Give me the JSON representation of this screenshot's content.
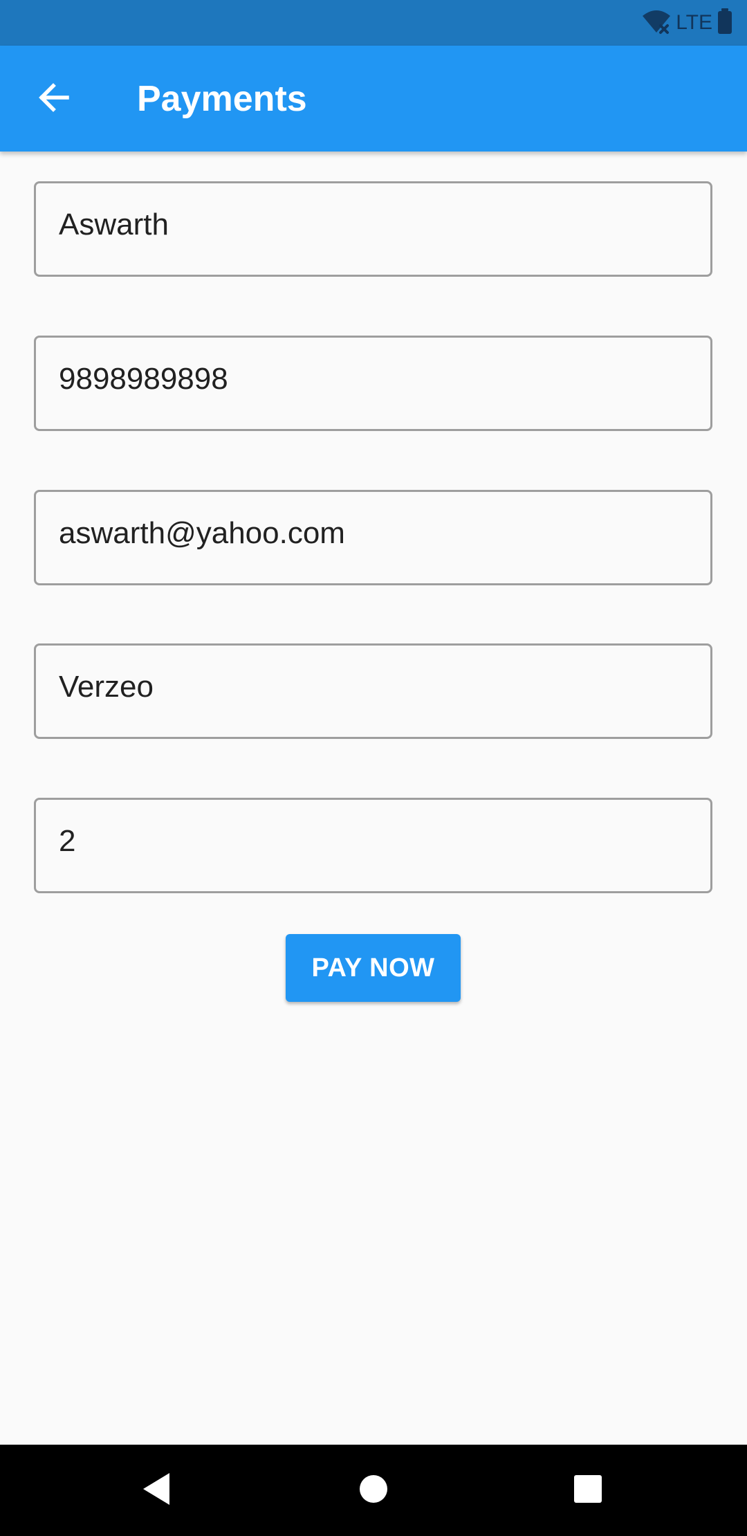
{
  "status_bar": {
    "network_label": "LTE",
    "icons": [
      "wifi-off-icon",
      "battery-icon"
    ]
  },
  "app_bar": {
    "title": "Payments",
    "back_icon": "arrow-left-icon",
    "color": "#2196f3"
  },
  "form": {
    "fields": [
      {
        "value": "Aswarth"
      },
      {
        "value": "9898989898"
      },
      {
        "value": "aswarth@yahoo.com"
      },
      {
        "value": "Verzeo"
      },
      {
        "value": "2"
      }
    ],
    "submit_label": "PAY NOW"
  },
  "nav_bar": {
    "icons": [
      "back-triangle-icon",
      "home-circle-icon",
      "recents-square-icon"
    ]
  },
  "colors": {
    "primary": "#2196f3",
    "status_bar": "#1e77bd",
    "background": "#fafafa",
    "field_border": "#9e9e9e"
  }
}
